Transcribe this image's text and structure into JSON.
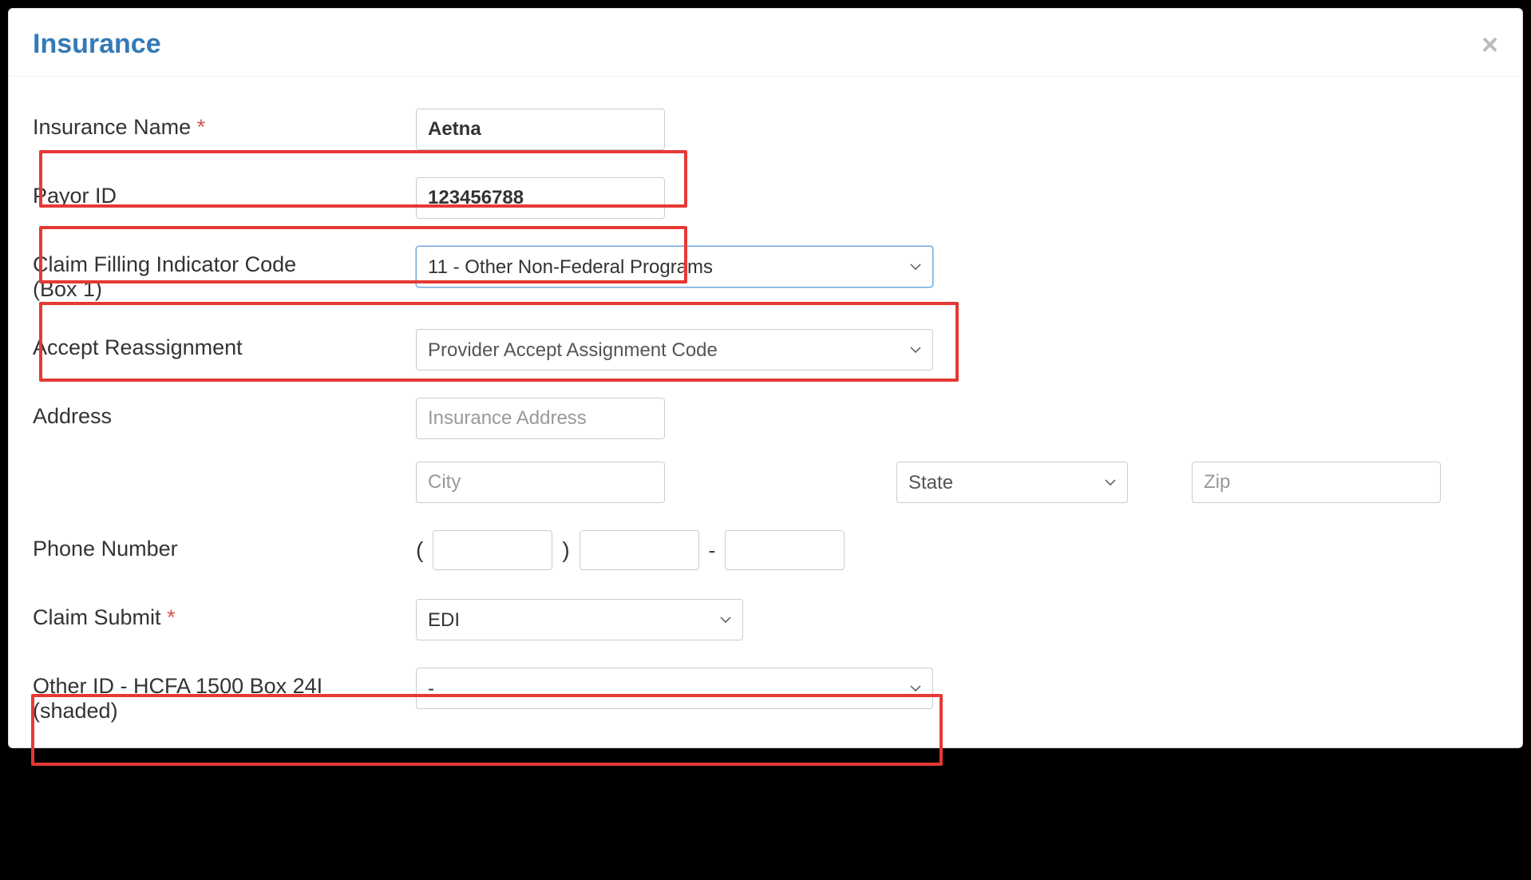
{
  "modal": {
    "title": "Insurance",
    "close_label": "×"
  },
  "fields": {
    "insurance_name": {
      "label": "Insurance Name",
      "required": "*",
      "value": "Aetna"
    },
    "payor_id": {
      "label": "Payor ID",
      "value": "123456788"
    },
    "claim_filling": {
      "label_line1": "Claim Filling Indicator Code",
      "label_line2": "(Box 1)",
      "value": "11 - Other Non-Federal Programs"
    },
    "accept_reassignment": {
      "label": "Accept Reassignment",
      "placeholder": "Provider Accept Assignment Code"
    },
    "address": {
      "label": "Address",
      "placeholder": "Insurance Address",
      "city_placeholder": "City",
      "state_placeholder": "State",
      "zip_placeholder": "Zip"
    },
    "phone": {
      "label": "Phone Number",
      "lparen": "(",
      "rparen": ")",
      "dash": "-"
    },
    "claim_submit": {
      "label": "Claim Submit",
      "required": "*",
      "value": "EDI"
    },
    "other_id": {
      "label_line1": "Other ID - HCFA 1500 Box 24I",
      "label_line2": "(shaded)",
      "value": "-"
    }
  }
}
